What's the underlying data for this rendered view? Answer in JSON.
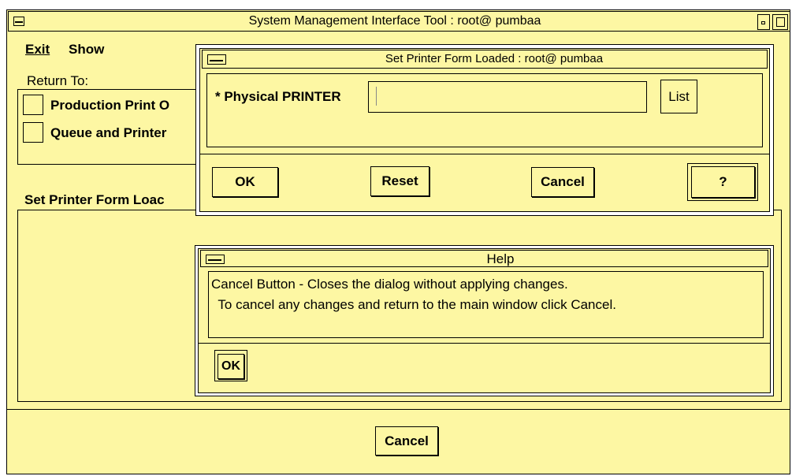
{
  "main": {
    "title": "System Management Interface Tool : root@ pumbaa",
    "menu": {
      "exit": "Exit",
      "show": "Show"
    },
    "return_to_label": "Return To:",
    "return_items": [
      "Production Print O",
      "Queue and Printer"
    ],
    "section_title": "Set Printer Form Loac",
    "cancel_label": "Cancel"
  },
  "dialog": {
    "title": "Set Printer Form Loaded : root@ pumbaa",
    "field_label": "* Physical PRINTER",
    "field_value": "",
    "list_label": "List",
    "ok_label": "OK",
    "reset_label": "Reset",
    "cancel_label": "Cancel",
    "help_label": "?"
  },
  "help": {
    "title": "Help",
    "line1": "Cancel Button - Closes the dialog without applying changes.",
    "line2": " To cancel any changes and return to the main window click Cancel.",
    "ok_label": "OK"
  }
}
